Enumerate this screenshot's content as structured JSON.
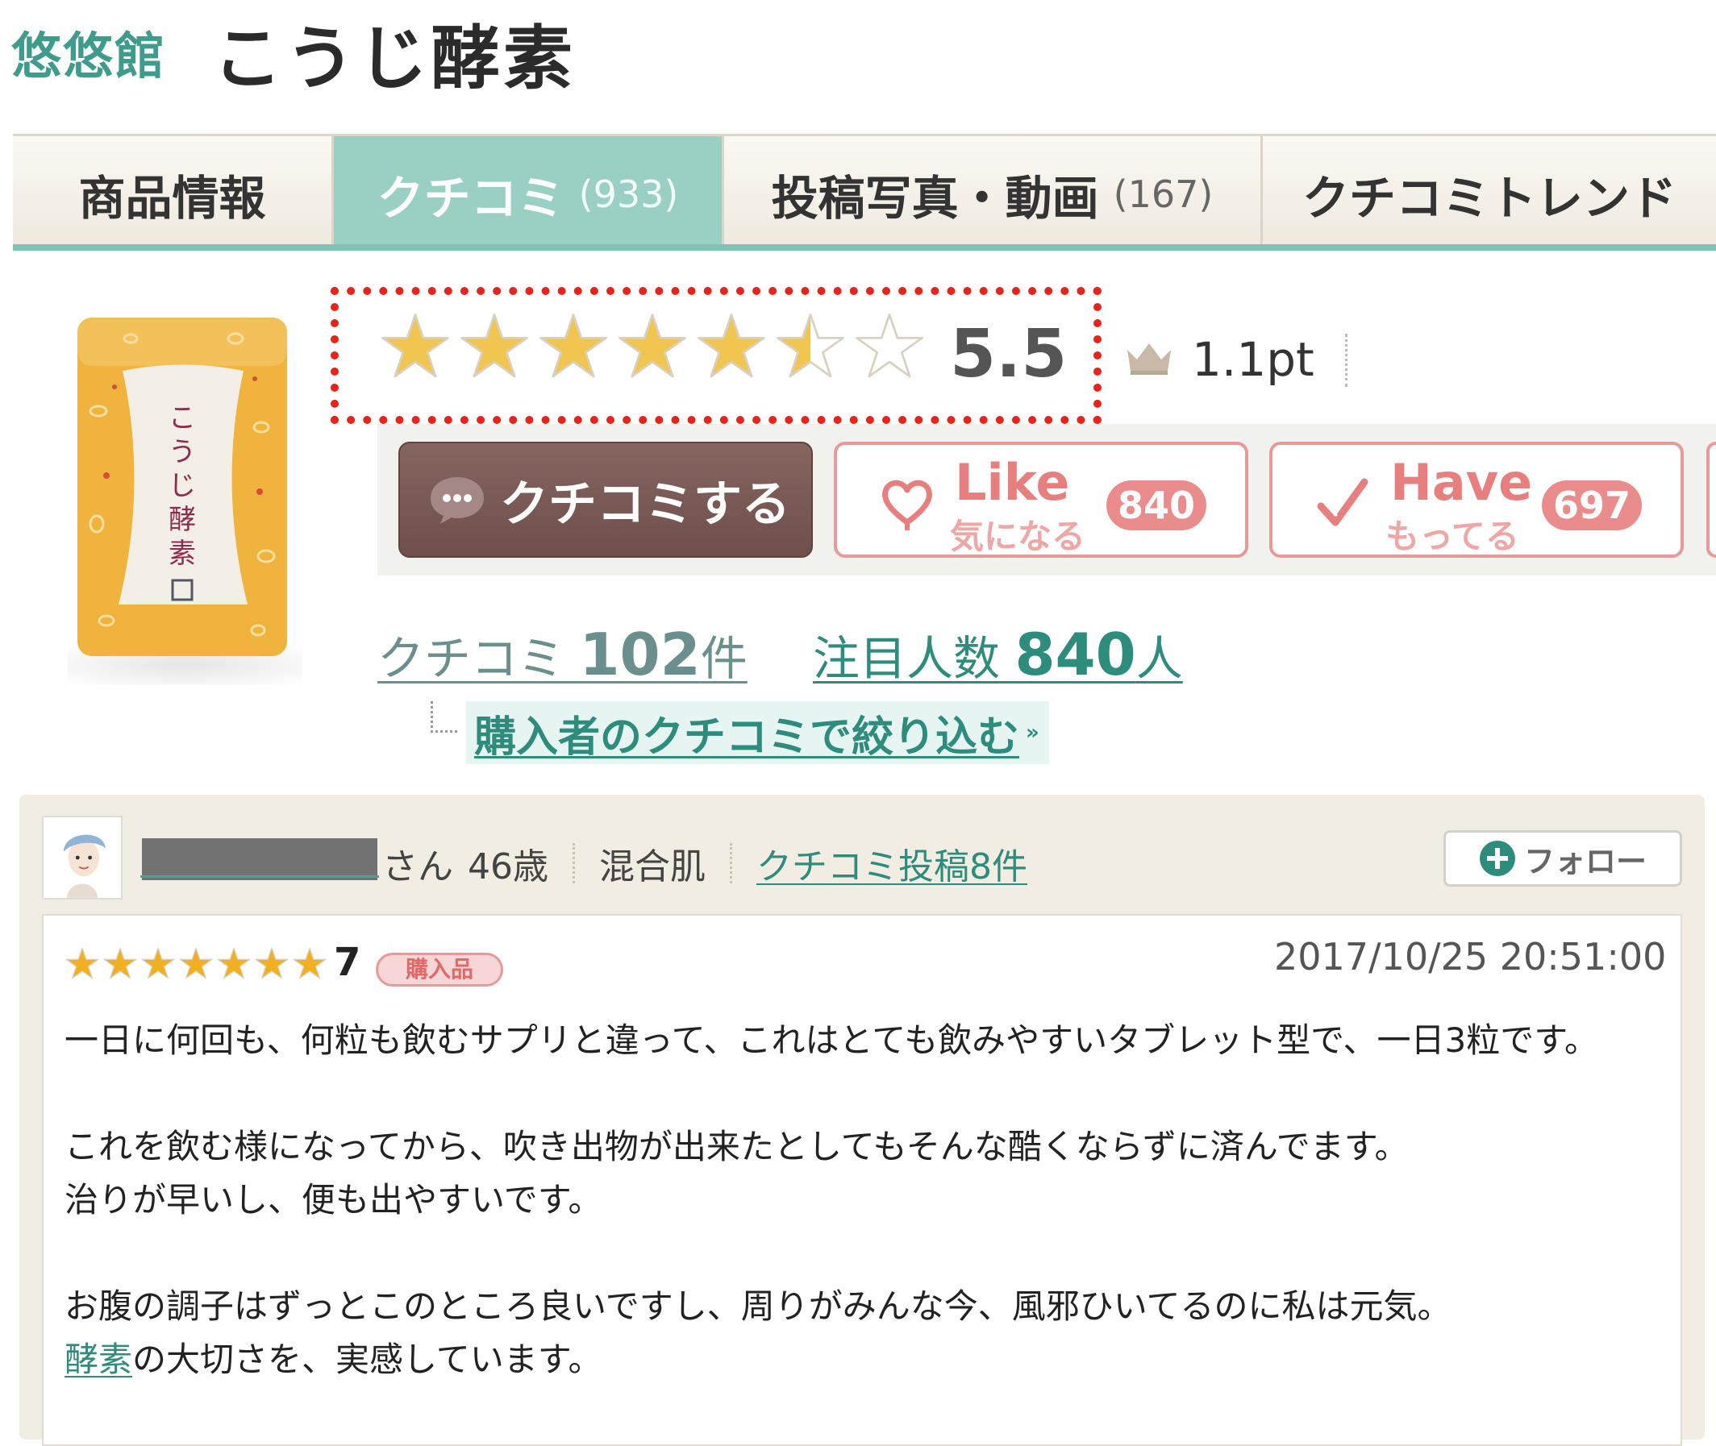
{
  "header": {
    "brand": "悠悠館",
    "product_name": "こうじ酵素"
  },
  "tabs": [
    {
      "label": "商品情報",
      "count": ""
    },
    {
      "label": "クチコミ",
      "count": "(933)"
    },
    {
      "label": "投稿写真・動画",
      "count": "(167)"
    },
    {
      "label": "クチコミトレンド",
      "count": ""
    }
  ],
  "product_image": {
    "label_text": "こうじ酵素",
    "bag_color": "#f0b33d",
    "label_color": "#f3efe6",
    "text_color": "#8e2c4f"
  },
  "rating": {
    "value": "5.5",
    "stars_filled": 5.5,
    "stars_total": 7,
    "points": "1.1pt",
    "star_color": "#f0c550"
  },
  "actions": {
    "review_button": "クチコミする",
    "like": {
      "label": "Like",
      "sub": "気になる",
      "count": "840"
    },
    "have": {
      "label": "Have",
      "sub": "もってる",
      "count": "697"
    }
  },
  "counts": {
    "reviews_label": "クチコミ",
    "reviews_num": "102",
    "reviews_unit": "件",
    "watch_label": "注目人数",
    "watch_num": "840",
    "watch_unit": "人"
  },
  "filter_link": {
    "label": "購入者のクチコミで絞り込む",
    "arrow": "»"
  },
  "review": {
    "user_suffix": "さん",
    "age": "46歳",
    "skin_type": "混合肌",
    "posts_link": "クチコミ投稿8件",
    "follow_label": "フォロー",
    "score": "7",
    "stars_filled": 7,
    "badge": "購入品",
    "date": "2017/10/25 20:51:00",
    "p1": "一日に何回も、何粒も飲むサプリと違って、これはとても飲みやすいタブレット型で、一日3粒です。",
    "p2_line1": "これを飲む様になってから、吹き出物が出来たとしてもそんな酷くならずに済んでます。",
    "p2_line2": "治りが早いし、便も出やすいです。",
    "p3_line1": "お腹の調子はずっとこのところ良いですし、周りがみんな今、風邪ひいてるのに私は元気。",
    "p3_keyword": "酵素",
    "p3_line2_rest": "の大切さを、実感しています。"
  },
  "colors": {
    "accent": "#3f9b8c",
    "tab_active": "#9ad0c4",
    "pink": "#e77f7e",
    "brown": "#7a5a56",
    "highlight_box": "#e8231a"
  }
}
